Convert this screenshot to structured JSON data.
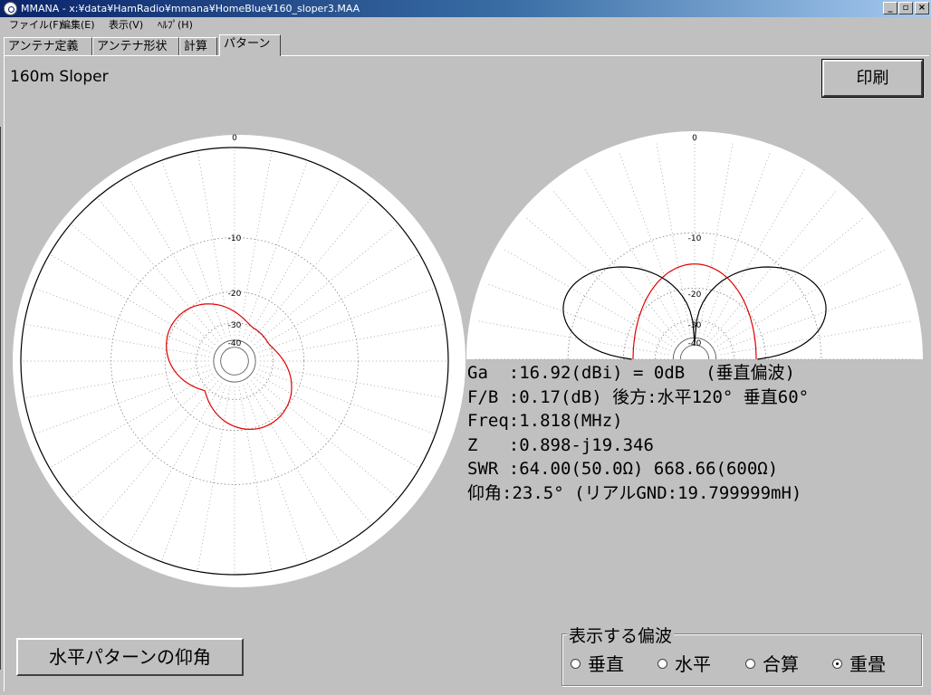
{
  "window": {
    "title": "MMANA - x:¥data¥HamRadio¥mmana¥HomeBlue¥160_sloper3.MAA",
    "controls": [
      "_",
      "▫",
      "×"
    ]
  },
  "menu": [
    "ファイル(F)",
    "編集(E)",
    "表示(V)",
    "ﾍﾙﾌﾟ(H)"
  ],
  "tabs": [
    {
      "label": "アンテナ定義",
      "active": false
    },
    {
      "label": "アンテナ形状",
      "active": false
    },
    {
      "label": "計算",
      "active": false
    },
    {
      "label": "パターン",
      "active": true
    }
  ],
  "page_title": "160m Sloper",
  "print_button": "印刷",
  "elevation_button": "水平パターンの仰角",
  "polar_labels": [
    "0",
    "-10",
    "-20",
    "-30",
    "-40"
  ],
  "chart_data": [
    {
      "type": "polar",
      "view": "horizontal",
      "rings_db": [
        0,
        -10,
        -20,
        -30,
        -40
      ],
      "series": [
        {
          "color": "#e00000",
          "shape": "cardioid lobes toward upper-left and lower-right, peak about -20 dB"
        }
      ]
    },
    {
      "type": "polar",
      "view": "vertical",
      "rings_db": [
        0,
        -10,
        -20,
        -30,
        -40
      ],
      "series": [
        {
          "color": "#000000",
          "shape": "two large lobes, max 0 dB, null near zenith"
        },
        {
          "color": "#e00000",
          "shape": "single smaller lobe, peak about -20 dB"
        }
      ]
    }
  ],
  "info": {
    "ga": "Ga  :16.92(dBi) = 0dB  (垂直偏波)",
    "fb": "F/B :0.17(dB) 後方:水平120° 垂直60°",
    "freq": "Freq:1.818(MHz)",
    "z": "Z   :0.898-j19.346",
    "swr": "SWR :64.00(50.0Ω) 668.66(600Ω)",
    "elev": "仰角:23.5° (リアルGND:19.799999mH)"
  },
  "polarization": {
    "label": "表示する偏波",
    "options": [
      {
        "label": "垂直",
        "checked": false
      },
      {
        "label": "水平",
        "checked": false
      },
      {
        "label": "合算",
        "checked": false
      },
      {
        "label": "重畳",
        "checked": true
      }
    ]
  }
}
